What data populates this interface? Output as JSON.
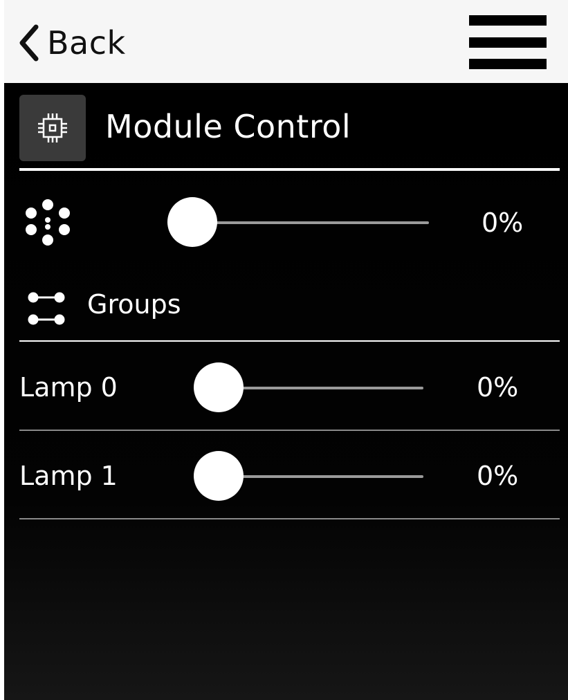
{
  "header": {
    "back_label": "Back",
    "back_icon": "chevron-left-icon",
    "menu_icon": "hamburger-menu-icon"
  },
  "module": {
    "title": "Module Control",
    "icon": "chip-icon"
  },
  "master": {
    "icon": "dots-pattern-icon",
    "value": 0,
    "value_label": "0%"
  },
  "groups": {
    "label": "Groups",
    "icon": "groups-toggle-icon"
  },
  "lamps": [
    {
      "name": "Lamp 0",
      "value": 0,
      "value_label": "0%"
    },
    {
      "name": "Lamp 1",
      "value": 0,
      "value_label": "0%"
    }
  ],
  "colors": {
    "header_bg": "#f6f6f6",
    "content_bg": "#000000",
    "accent": "#ffffff",
    "track": "#9a9a9a",
    "icon_box": "#3a3a3a"
  }
}
